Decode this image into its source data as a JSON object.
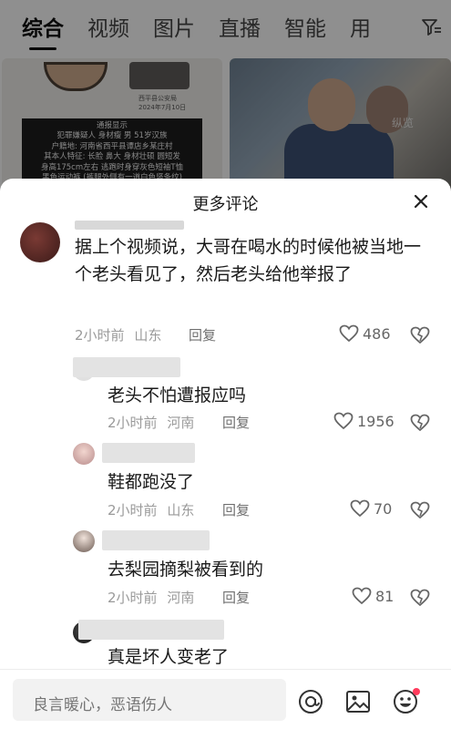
{
  "tabs": [
    {
      "label": "综合",
      "active": true
    },
    {
      "label": "视频",
      "active": false
    },
    {
      "label": "图片",
      "active": false
    },
    {
      "label": "直播",
      "active": false
    },
    {
      "label": "智能",
      "active": false
    },
    {
      "label": "用",
      "active": false
    }
  ],
  "background": {
    "left_thumb_date": "西平县公安局\n2024年7月10日",
    "notice_text": "通报显示\n犯罪嫌疑人 身材瘦 男 51岁汉族\n户籍地: 河南省西平县谭店乡某庄村\n其本人特征: 长脸 鼻大 身材壮硕 圆短发\n身高175cm左右 逃跑时身穿灰色短袖T恤\n黑色运动裤 (裤腿外侧有一道白色竖条纹)\n深色鞋子",
    "right_thumb_watermark": "纵览"
  },
  "sheet": {
    "title": "更多评论",
    "close_icon": "close-icon"
  },
  "comments": [
    {
      "user": "",
      "text": "据上个视频说，大哥在喝水的时候他被当地一个老头看见了，然后老头给他举报了",
      "time": "2小时前",
      "location": "山东",
      "reply_label": "回复",
      "likes": "486"
    },
    {
      "user": "",
      "text": "老头不怕遭报应吗",
      "time": "2小时前",
      "location": "河南",
      "reply_label": "回复",
      "likes": "1956"
    },
    {
      "user": "",
      "text": "鞋都跑没了",
      "time": "2小时前",
      "location": "山东",
      "reply_label": "回复",
      "likes": "70"
    },
    {
      "user": "",
      "text": "去梨园摘梨被看到的",
      "time": "2小时前",
      "location": "河南",
      "reply_label": "回复",
      "likes": "81"
    },
    {
      "user": "",
      "text": "真是坏人变老了"
    }
  ],
  "input": {
    "placeholder": "良言暖心，恶语伤人"
  },
  "colors": {
    "notification_dot": "#ff3b5c",
    "text_primary": "#1a1a1a",
    "text_meta": "#9a9a9a"
  }
}
